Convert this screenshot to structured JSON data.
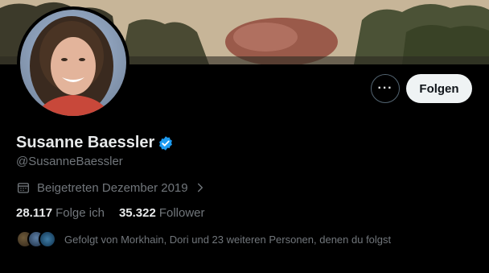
{
  "profile": {
    "name": "Susanne Baessler",
    "handle": "@SusanneBaessler",
    "joined": "Beigetreten Dezember 2019",
    "following_count": "28.117",
    "following_label": "Folge ich",
    "followers_count": "35.322",
    "followers_label": "Follower",
    "followed_by_text": "Gefolgt von Morkhain, Dori und 23 weiteren Personen, denen du folgst"
  },
  "actions": {
    "more_label": "···",
    "follow_label": "Folgen"
  },
  "colors": {
    "background": "#000000",
    "text_primary": "#e7e9ea",
    "text_secondary": "#71767b",
    "verified_blue": "#1d9bf0",
    "follow_button_bg": "#eff3f4"
  },
  "icons": {
    "verified": "verified-badge-icon",
    "calendar": "calendar-icon",
    "chevron": "chevron-right-icon",
    "more": "more-horizontal-icon"
  }
}
